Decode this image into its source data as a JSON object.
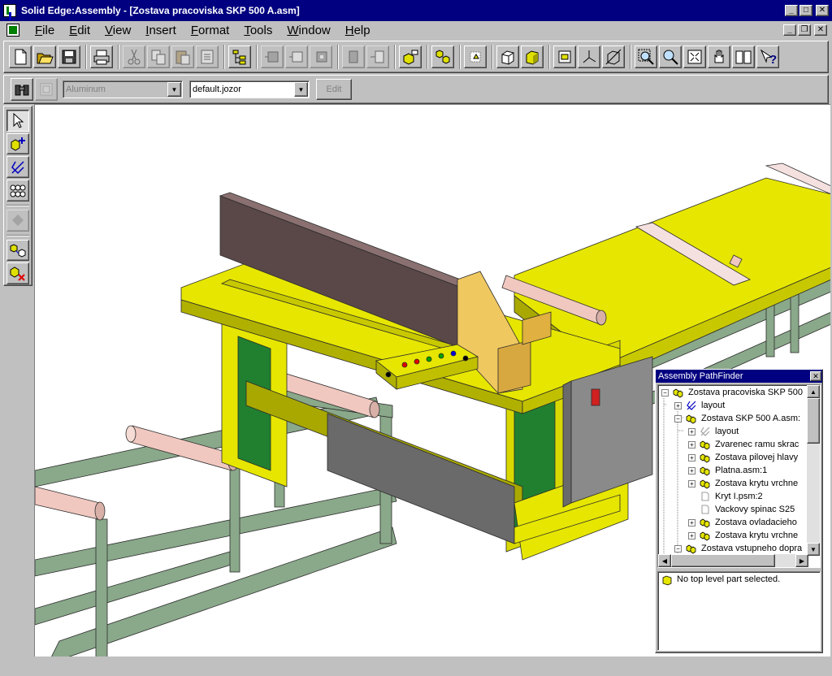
{
  "window": {
    "title": "Solid Edge:Assembly - [Zostava pracoviska SKP 500 A.asm]",
    "buttons": {
      "minimize": "_",
      "maximize": "□",
      "close": "✕",
      "restore": "❐"
    }
  },
  "menu": {
    "items": [
      "File",
      "Edit",
      "View",
      "Insert",
      "Format",
      "Tools",
      "Window",
      "Help"
    ]
  },
  "toolbar1": {
    "icons": [
      "new-icon",
      "open-icon",
      "save-icon",
      "print-icon",
      "cut-icon",
      "copy-icon",
      "paste-icon",
      "paste-special-icon",
      "pathfinder-icon",
      "align-icon",
      "mate-icon",
      "insert-icon",
      "axial-align-icon",
      "flash-fit-icon",
      "place-part-icon",
      "move-parts-icon",
      "properties-icon",
      "shaded-icon",
      "solid-icon",
      "filter-icon",
      "coordinate-icon",
      "view-orientation-icon",
      "zoom-area-icon",
      "zoom-icon",
      "fit-icon",
      "pan-icon",
      "book-icon",
      "help-icon"
    ]
  },
  "toolbar2": {
    "material": "Aluminum",
    "style": "default.jozor",
    "edit_label": "Edit"
  },
  "side_toolbar": {
    "icons": [
      "select-icon",
      "place-part-icon",
      "layout-icon",
      "pattern-icon",
      "feature-icon",
      "replace-part-icon",
      "delete-part-icon"
    ]
  },
  "pathfinder": {
    "title": "Assembly PathFinder",
    "tree": [
      {
        "label": "Zostava pracoviska SKP 500",
        "level": 0,
        "toggle": "−",
        "icon": "assembly"
      },
      {
        "label": "layout",
        "level": 1,
        "toggle": "+",
        "icon": "layout"
      },
      {
        "label": "Zostava SKP 500 A.asm:",
        "level": 1,
        "toggle": "−",
        "icon": "assembly"
      },
      {
        "label": "layout",
        "level": 2,
        "toggle": "+",
        "icon": "layout-gray"
      },
      {
        "label": "Zvarenec ramu skrac",
        "level": 2,
        "toggle": "+",
        "icon": "assembly"
      },
      {
        "label": "Zostava pilovej hlavy",
        "level": 2,
        "toggle": "+",
        "icon": "assembly"
      },
      {
        "label": "Platna.asm:1",
        "level": 2,
        "toggle": "+",
        "icon": "assembly"
      },
      {
        "label": "Zostava krytu vrchne",
        "level": 2,
        "toggle": "+",
        "icon": "assembly"
      },
      {
        "label": "Kryt I.psm:2",
        "level": 2,
        "toggle": "",
        "icon": "part"
      },
      {
        "label": "Vackovy spinac S25",
        "level": 2,
        "toggle": "",
        "icon": "part"
      },
      {
        "label": "Zostava ovladacieho",
        "level": 2,
        "toggle": "+",
        "icon": "assembly"
      },
      {
        "label": "Zostava krytu vrchne",
        "level": 2,
        "toggle": "+",
        "icon": "assembly"
      },
      {
        "label": "Zostava vstupneho dopra",
        "level": 1,
        "toggle": "−",
        "icon": "assembly"
      }
    ],
    "status": "No top level part selected."
  },
  "colors": {
    "frame": "#8aa88a",
    "table": "#e6e600",
    "roller": "#f0c8c0",
    "fence": "#5a4848",
    "head": "#f0c860",
    "cabinet": "#8a8a8a",
    "panel": "#208030"
  }
}
